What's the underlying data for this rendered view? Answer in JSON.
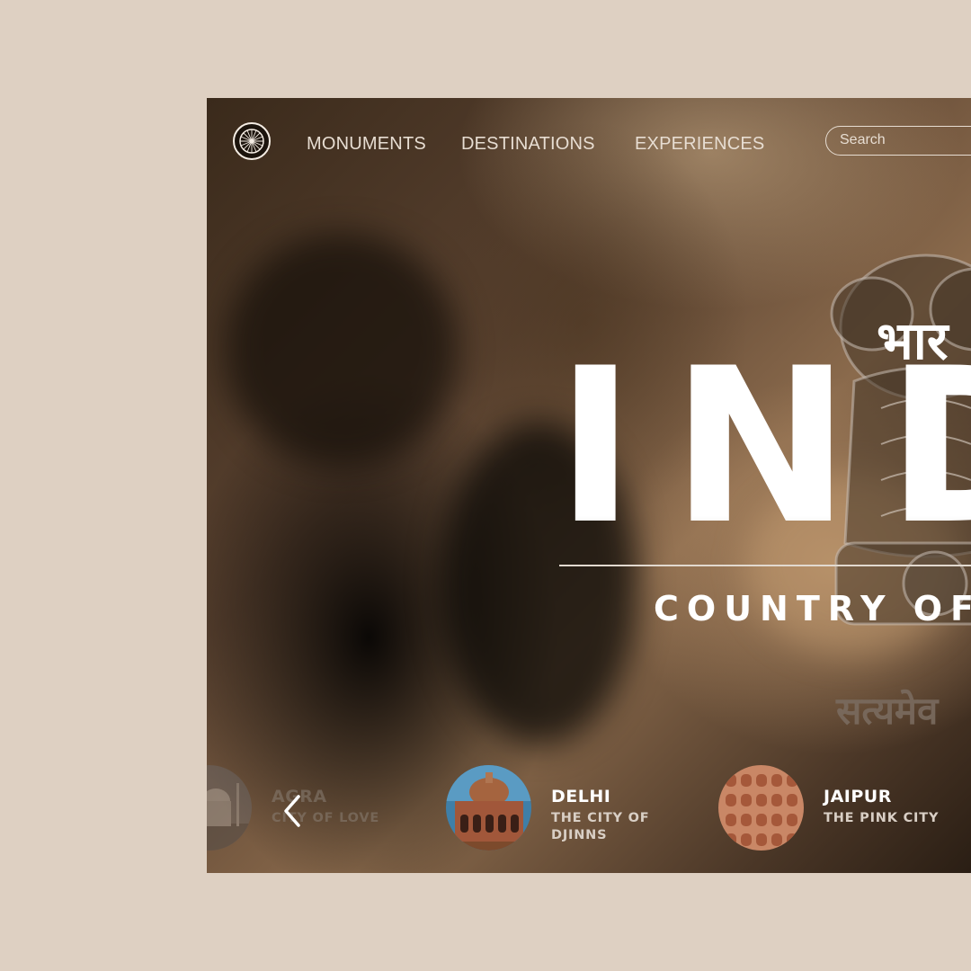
{
  "nav": {
    "links": [
      "MONUMENTS",
      "DESTINATIONS",
      "EXPERIENCES"
    ],
    "search_placeholder": "Search",
    "logo_icon": "ashoka-chakra-icon"
  },
  "hero": {
    "hindi_heading": "भार",
    "title": "INDIA",
    "subtitle": "COUNTRY OF",
    "motto": "सत्यमेव",
    "emblem_icon": "national-emblem-icon"
  },
  "carousel": {
    "prev_icon": "chevron-left-icon",
    "cities": [
      {
        "name": "AGRA",
        "tagline": "CITY OF LOVE",
        "thumb_icon": "taj-mahal-thumbnail"
      },
      {
        "name": "DELHI",
        "tagline": "THE CITY OF DJINNS",
        "thumb_icon": "humayun-tomb-thumbnail"
      },
      {
        "name": "JAIPUR",
        "tagline": "THE PINK CITY",
        "thumb_icon": "hawa-mahal-thumbnail"
      }
    ]
  },
  "colors": {
    "page_background": "#ded0c2",
    "text_light": "#e7ddd2",
    "accent_white": "#ffffff"
  }
}
